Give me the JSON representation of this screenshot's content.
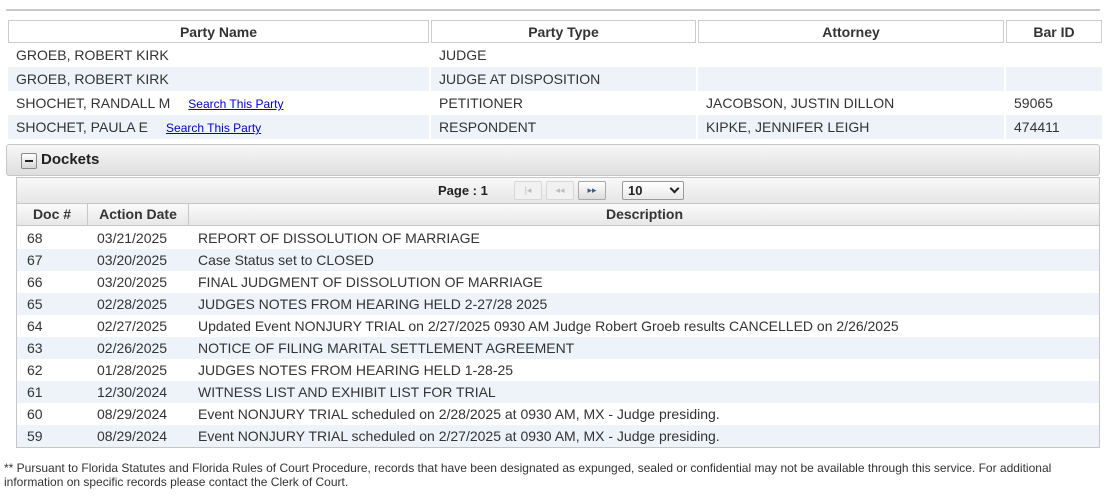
{
  "parties": {
    "headers": [
      "Party Name",
      "Party Type",
      "Attorney",
      "Bar ID"
    ],
    "rows": [
      {
        "name": "GROEB, ROBERT KIRK",
        "link": "",
        "type": "JUDGE",
        "attorney": "",
        "bar_id": ""
      },
      {
        "name": "GROEB, ROBERT KIRK",
        "link": "",
        "type": "JUDGE AT DISPOSITION",
        "attorney": "",
        "bar_id": ""
      },
      {
        "name": "SHOCHET, RANDALL M",
        "link": "Search This Party",
        "type": "PETITIONER",
        "attorney": "JACOBSON, JUSTIN DILLON",
        "bar_id": "59065"
      },
      {
        "name": "SHOCHET, PAULA E",
        "link": "Search This Party",
        "type": "RESPONDENT",
        "attorney": "KIPKE, JENNIFER LEIGH",
        "bar_id": "474411"
      }
    ]
  },
  "dockets": {
    "title": "Dockets",
    "collapse_icon": "minus-icon",
    "pager": {
      "label": "Page : 1",
      "first_glyph": "|◂",
      "prev_glyph": "◂◂",
      "next_glyph": "▸▸",
      "page_size": "10"
    },
    "headers": [
      "Doc #",
      "Action Date",
      "Description"
    ],
    "rows": [
      {
        "doc": "68",
        "date": "03/21/2025",
        "desc": "REPORT OF DISSOLUTION OF MARRIAGE"
      },
      {
        "doc": "67",
        "date": "03/20/2025",
        "desc": "Case Status set to CLOSED"
      },
      {
        "doc": "66",
        "date": "03/20/2025",
        "desc": "FINAL JUDGMENT OF DISSOLUTION OF MARRIAGE"
      },
      {
        "doc": "65",
        "date": "02/28/2025",
        "desc": "JUDGES NOTES FROM HEARING HELD 2-27/28 2025"
      },
      {
        "doc": "64",
        "date": "02/27/2025",
        "desc": "Updated Event NONJURY TRIAL on 2/27/2025 0930 AM Judge Robert Groeb results CANCELLED on 2/26/2025"
      },
      {
        "doc": "63",
        "date": "02/26/2025",
        "desc": "NOTICE OF FILING MARITAL SETTLEMENT AGREEMENT"
      },
      {
        "doc": "62",
        "date": "01/28/2025",
        "desc": "JUDGES NOTES FROM HEARING HELD 1-28-25"
      },
      {
        "doc": "61",
        "date": "12/30/2024",
        "desc": "WITNESS LIST AND EXHIBIT LIST FOR TRIAL"
      },
      {
        "doc": "60",
        "date": "08/29/2024",
        "desc": "Event NONJURY TRIAL scheduled on 2/28/2025 at 0930 AM, MX - Judge presiding."
      },
      {
        "doc": "59",
        "date": "08/29/2024",
        "desc": "Event NONJURY TRIAL scheduled on 2/27/2025 at 0930 AM, MX - Judge presiding."
      }
    ]
  },
  "footnote": "** Pursuant to Florida Statutes and Florida Rules of Court Procedure, records that have been designated as expunged, sealed or confidential may not be available through this service. For additional information on specific records please contact the Clerk of Court.",
  "colors": {
    "row_alt": "#eef3f9",
    "link": "#0000cc",
    "border": "#c6c6c6"
  }
}
